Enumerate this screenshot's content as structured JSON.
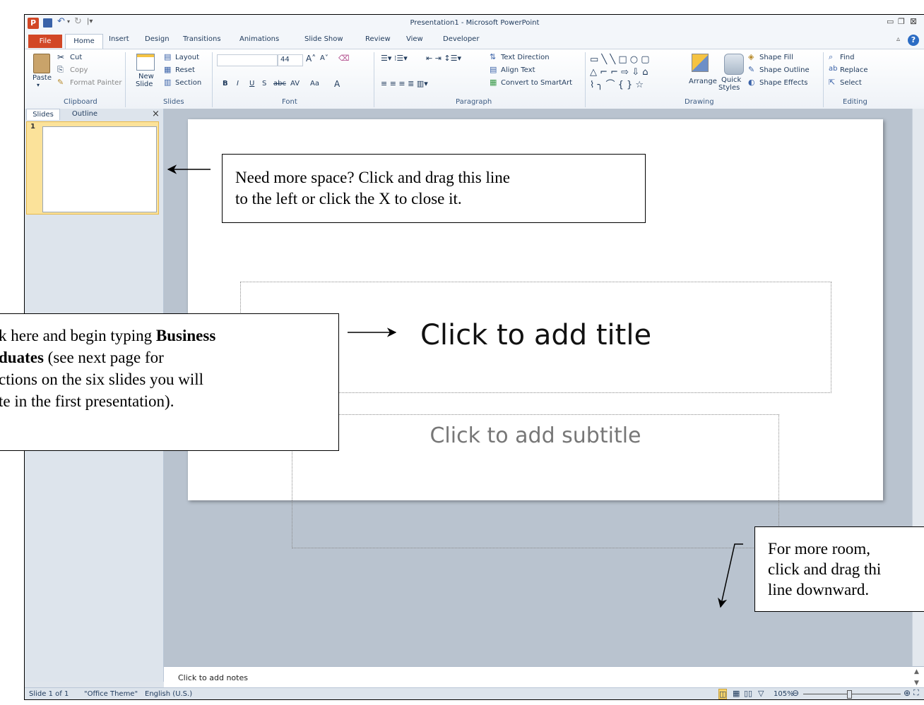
{
  "window": {
    "title": "Presentation1 - Microsoft PowerPoint"
  },
  "tabs": [
    "File",
    "Home",
    "Insert",
    "Design",
    "Transitions",
    "Animations",
    "Slide Show",
    "Review",
    "View",
    "Developer"
  ],
  "ribbon": {
    "clipboard": {
      "paste": "Paste",
      "cut": "Cut",
      "copy": "Copy",
      "format_painter": "Format Painter",
      "label": "Clipboard"
    },
    "slides": {
      "new_slide_1": "New",
      "new_slide_2": "Slide",
      "layout": "Layout",
      "reset": "Reset",
      "section": "Section",
      "label": "Slides"
    },
    "font": {
      "size": "44",
      "label": "Font",
      "bold": "B",
      "italic": "I",
      "underline": "U",
      "shadow": "S",
      "strike": "abc",
      "spacing": "AV",
      "case": "Aa",
      "color": "A"
    },
    "paragraph": {
      "text_direction": "Text Direction",
      "align_text": "Align Text",
      "convert_smartart": "Convert to SmartArt",
      "label": "Paragraph"
    },
    "drawing": {
      "arrange": "Arrange",
      "quick_styles_1": "Quick",
      "quick_styles_2": "Styles",
      "shape_fill": "Shape Fill",
      "shape_outline": "Shape Outline",
      "shape_effects": "Shape Effects",
      "label": "Drawing"
    },
    "editing": {
      "find": "Find",
      "replace": "Replace",
      "select": "Select",
      "label": "Editing"
    }
  },
  "pane": {
    "tab_slides": "Slides",
    "tab_outline": "Outline",
    "close": "×",
    "slide_number": "1"
  },
  "slide": {
    "title_placeholder": "Click to add title",
    "subtitle_placeholder": "Click to add subtitle"
  },
  "notes": {
    "placeholder": "Click to add notes"
  },
  "status": {
    "slide_info": "Slide 1 of 1",
    "theme": "\"Office Theme\"",
    "language": "English (U.S.)",
    "zoom": "105%"
  },
  "callouts": {
    "top_line1": "Need more space? Click and drag this line",
    "top_line2": "to the left or click the X to close it.",
    "left_line1_a": "k here and begin typing ",
    "left_line1_b": "Business",
    "left_line2_a": "duates",
    "left_line2_b": " (see next page for",
    "left_line3": "ctions on the six slides you will",
    "left_line4": "te in the first presentation).",
    "right_line1": "For more room,",
    "right_line2": "click and drag thi",
    "right_line3": "line downward."
  },
  "colors": {
    "file_tab": "#d24726",
    "ribbon_text": "#1e395b",
    "accent": "#f5c342",
    "help": "#2b6cc4"
  }
}
